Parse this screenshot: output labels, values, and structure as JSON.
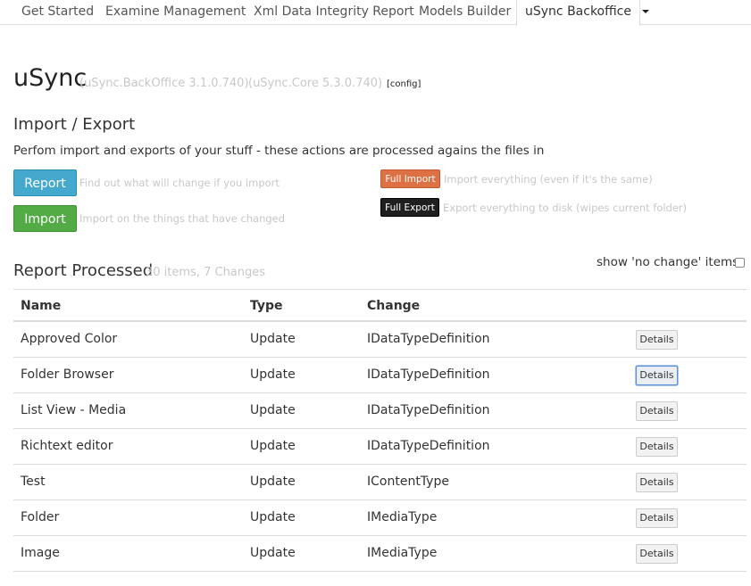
{
  "tabs": [
    {
      "label": "Get Started"
    },
    {
      "label": "Examine Management"
    },
    {
      "label": "Xml Data Integrity Report"
    },
    {
      "label": "Models Builder"
    },
    {
      "label": "uSync Backoffice"
    }
  ],
  "header": {
    "title": "uSync",
    "backoffice_version": "(uSync.BackOffice 3.1.0.740)",
    "core_version": "(uSync.Core 5.3.0.740)",
    "config_link": "[config]"
  },
  "import_export": {
    "title": "Import / Export",
    "description": "Perfom import and exports of your stuff - these actions are processed agains the files in",
    "report_button": "Report",
    "report_hint": "Find out what will change if you import",
    "import_button": "Import",
    "import_hint": "Import on the things that have changed",
    "full_import_button": "Full Import",
    "full_import_hint": "Import everything (even if it's the same)",
    "full_export_button": "Full Export",
    "full_export_hint": "Export everything to disk (wipes current folder)"
  },
  "report": {
    "title": "Report Processed",
    "summary": "30 items, 7 Changes",
    "show_nochange_label": "show 'no change' items",
    "show_nochange_checked": false,
    "columns": [
      "Name",
      "Type",
      "Change"
    ],
    "rows": [
      {
        "name": "Approved Color",
        "type": "Update",
        "change": "IDataTypeDefinition",
        "action": "Details"
      },
      {
        "name": "Folder Browser",
        "type": "Update",
        "change": "IDataTypeDefinition",
        "action": "Details"
      },
      {
        "name": "List View - Media",
        "type": "Update",
        "change": "IDataTypeDefinition",
        "action": "Details"
      },
      {
        "name": "Richtext editor",
        "type": "Update",
        "change": "IDataTypeDefinition",
        "action": "Details"
      },
      {
        "name": "Test",
        "type": "Update",
        "change": "IContentType",
        "action": "Details"
      },
      {
        "name": "Folder",
        "type": "Update",
        "change": "IMediaType",
        "action": "Details"
      },
      {
        "name": "Image",
        "type": "Update",
        "change": "IMediaType",
        "action": "Details"
      }
    ]
  },
  "colors": {
    "report_button": "#44a9cd",
    "import_button": "#53ab45",
    "full_import_button": "#dd7143",
    "full_export_button": "#1f1f1f",
    "muted_text": "#c8c8c8"
  },
  "icons": {
    "tab_overflow": "chevron-down-icon"
  }
}
